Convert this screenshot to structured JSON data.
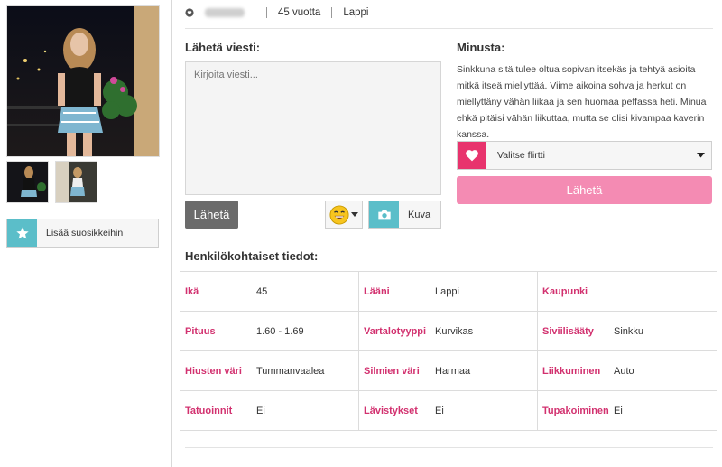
{
  "profile": {
    "age_text": "45 vuotta",
    "region": "Lappi"
  },
  "message": {
    "heading": "Lähetä viesti:",
    "placeholder": "Kirjoita viesti...",
    "send_label": "Lähetä",
    "photo_label": "Kuva"
  },
  "about": {
    "heading": "Minusta:",
    "text": "Sinkkuna sitä tulee oltua sopivan itsekäs ja tehtyä asioita mitkä itseä miellyttää. Viime aikoina sohva ja herkut on miellyttäny vähän liikaa ja sen huomaa peffassa heti. Minua ehkä pitäisi vähän liikuttaa, mutta se olisi kivampaa kaverin kanssa."
  },
  "flirt": {
    "select_label": "Valitse flirtti",
    "send_label": "Lähetä"
  },
  "favorites": {
    "label": "Lisää suosikkeihin"
  },
  "personal": {
    "heading": "Henkilökohtaiset tiedot:",
    "rows": [
      [
        {
          "label": "Ikä",
          "value": "45"
        },
        {
          "label": "Lääni",
          "value": "Lappi"
        },
        {
          "label": "Kaupunki",
          "value": ""
        }
      ],
      [
        {
          "label": "Pituus",
          "value": "1.60 - 1.69"
        },
        {
          "label": "Vartalotyyppi",
          "value": "Kurvikas"
        },
        {
          "label": "Siviilisääty",
          "value": "Sinkku"
        }
      ],
      [
        {
          "label": "Hiusten väri",
          "value": "Tummanvaalea"
        },
        {
          "label": "Silmien väri",
          "value": "Harmaa"
        },
        {
          "label": "Liikkuminen",
          "value": "Auto"
        }
      ],
      [
        {
          "label": "Tatuoinnit",
          "value": "Ei"
        },
        {
          "label": "Lävistykset",
          "value": "Ei"
        },
        {
          "label": "Tupakoiminen",
          "value": "Ei"
        }
      ]
    ]
  },
  "colors": {
    "accent_pink": "#e8336d",
    "button_pink": "#f48bb3",
    "teal": "#5bbec9",
    "label_pink": "#d2316f"
  }
}
